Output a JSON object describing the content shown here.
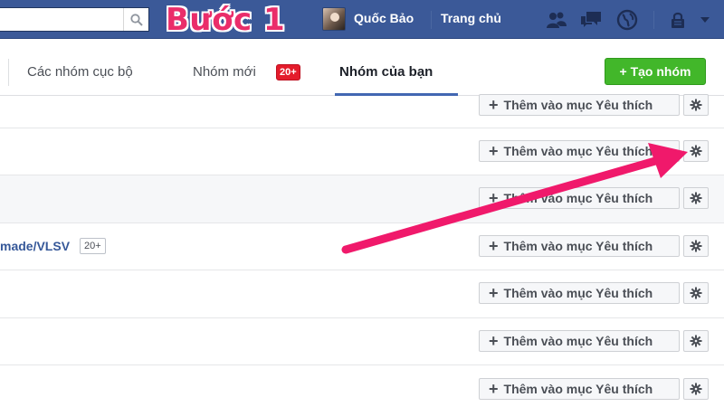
{
  "header": {
    "step_label": "Bước 1",
    "user_name": "Quốc Bảo",
    "home_label": "Trang chủ",
    "icons": [
      "search-icon",
      "friend-requests-icon",
      "messages-icon",
      "notifications-globe-icon",
      "privacy-lock-icon",
      "settings-chevron-icon"
    ]
  },
  "tabs": {
    "local_groups": "Các nhóm cục bộ",
    "new_groups": "Nhóm mới",
    "new_groups_badge": "20+",
    "your_groups": "Nhóm của bạn",
    "create_group": "+ Tạo nhóm"
  },
  "groups": {
    "partial_name": "made/VLSV",
    "partial_badge": "20+",
    "favorite_label": "Thêm vào mục Yêu thích"
  },
  "colors": {
    "topbar": "#3b5998",
    "step_text": "#ea2d6a",
    "annotation_arrow": "#f0196b",
    "create_button": "#42b72a",
    "badge_red": "#e41c2b",
    "link_blue": "#365899"
  }
}
